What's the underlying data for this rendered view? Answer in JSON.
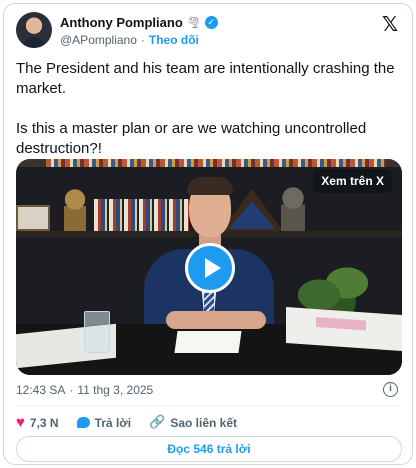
{
  "author": {
    "name": "Anthony Pompliano",
    "handle": "@APompliano",
    "separator": "·",
    "follow_label": "Theo dõi"
  },
  "tweet": {
    "paragraph1": "The President and his team are intentionally crashing the market.",
    "paragraph2": "Is this a master plan or are we watching uncontrolled destruction?!"
  },
  "media": {
    "watch_on_x_label": "Xem trên X"
  },
  "meta": {
    "time": "12:43 SA",
    "separator": "·",
    "date": "11 thg 3, 2025"
  },
  "actions": {
    "like_count": "7,3 N",
    "reply_label": "Trả lời",
    "copy_link_label": "Sao liên kết"
  },
  "footer": {
    "read_replies_label": "Đọc 546 trả lời"
  },
  "icons": {
    "brand": "x-logo-icon",
    "verified": "verified-badge-icon",
    "emoji": "tornado-icon",
    "play": "play-icon",
    "info": "info-icon",
    "like": "heart-icon",
    "reply": "reply-bubble-icon",
    "link": "link-icon"
  },
  "colors": {
    "accent": "#1d9bf0",
    "like": "#f91880",
    "muted": "#536471"
  }
}
